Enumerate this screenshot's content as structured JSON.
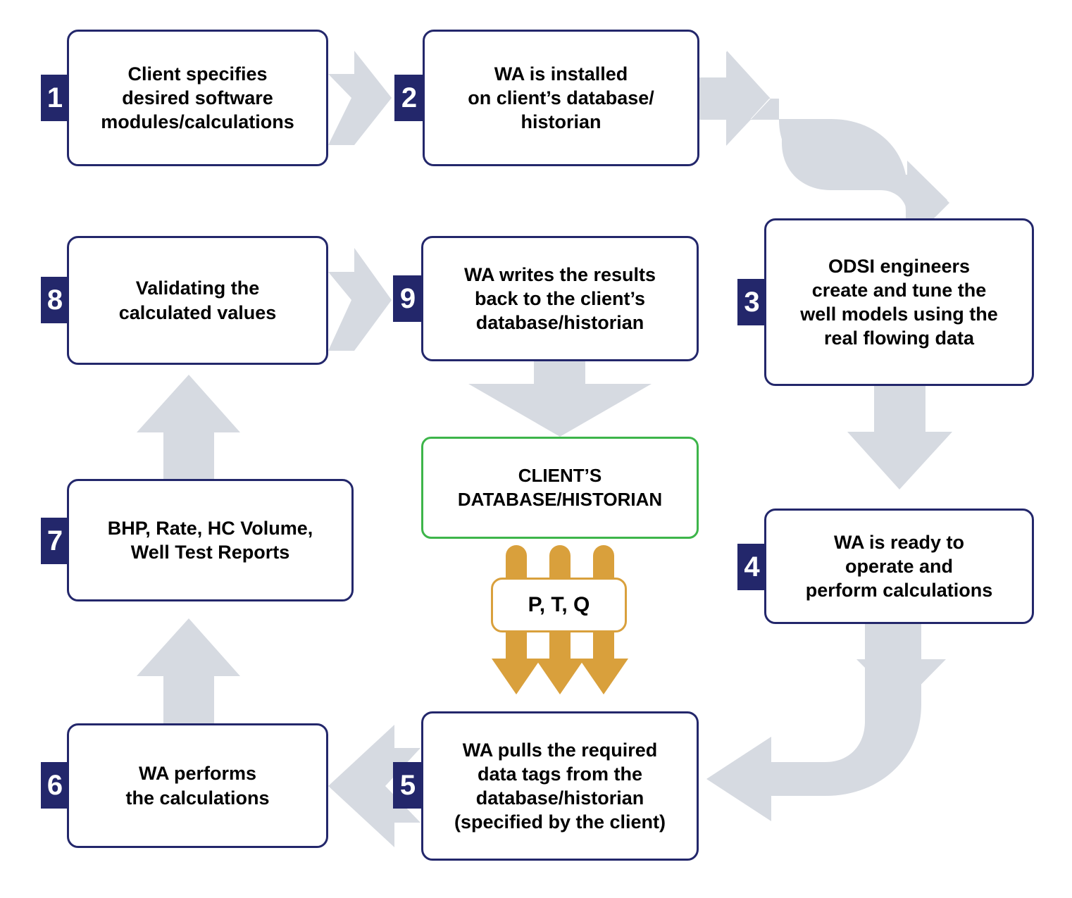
{
  "diagram": {
    "title": "WA workflow process diagram",
    "colors": {
      "box_border": "#23276B",
      "badge_bg": "#23276B",
      "badge_text": "#FFFFFF",
      "arrow_gray": "#D6DAE1",
      "db_border_green": "#3DB54A",
      "flow_orange": "#D9A03C",
      "text": "#000000",
      "background": "#FFFFFF"
    },
    "steps": [
      {
        "number": "1",
        "text": "Client specifies\ndesired software\nmodules/calculations"
      },
      {
        "number": "2",
        "text": "WA is installed\non client’s database/\nhistorian"
      },
      {
        "number": "3",
        "text": "ODSI engineers\ncreate and tune the\nwell models using the\nreal flowing data"
      },
      {
        "number": "4",
        "text": "WA is ready to\noperate and\nperform calculations"
      },
      {
        "number": "5",
        "text": "WA pulls the required\ndata tags from the\ndatabase/historian\n(specified by the client)"
      },
      {
        "number": "6",
        "text": "WA performs\nthe calculations"
      },
      {
        "number": "7",
        "text": "BHP, Rate, HC Volume,\nWell Test Reports"
      },
      {
        "number": "8",
        "text": "Validating the\ncalculated values"
      },
      {
        "number": "9",
        "text": "WA writes the results\nback to the client’s\ndatabase/historian"
      }
    ],
    "database_node": {
      "text": "CLIENT’S\nDATABASE/HISTORIAN"
    },
    "data_flow": {
      "label": "P, T, Q"
    }
  }
}
